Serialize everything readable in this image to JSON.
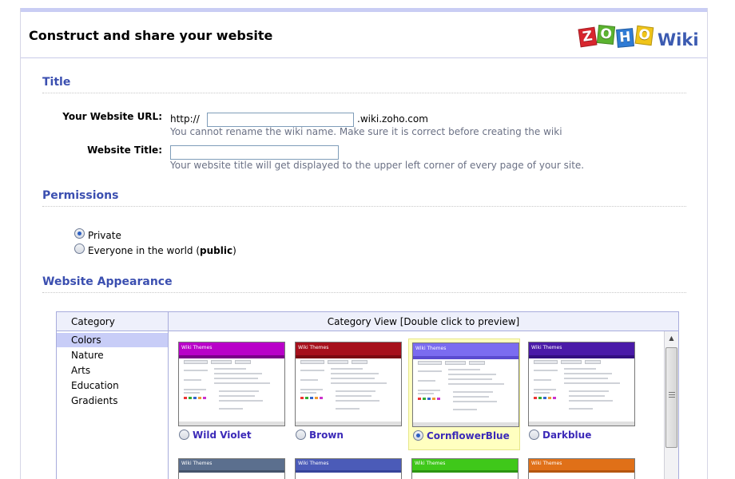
{
  "header": {
    "title": "Construct and share your website",
    "logo_letters": [
      "Z",
      "O",
      "H",
      "O"
    ],
    "logo_word": "Wiki"
  },
  "sections": {
    "title": "Title",
    "permissions": "Permissions",
    "appearance": "Website Appearance"
  },
  "form": {
    "url_label": "Your Website URL:",
    "url_prefix": "http://",
    "url_value": "",
    "url_suffix": ".wiki.zoho.com",
    "url_hint": "You cannot rename the wiki name. Make sure it is correct before creating the wiki",
    "title_label": "Website Title:",
    "title_value": "",
    "title_hint": "Your website title will get displayed to the upper left corner of every page of your site."
  },
  "permissions": {
    "options": [
      {
        "label": "Private",
        "selected": true
      },
      {
        "label_prefix": "Everyone in the world (",
        "label_bold": "public",
        "label_suffix": ")",
        "selected": false
      }
    ]
  },
  "appearance": {
    "category_header": "Category",
    "view_header": "Category View [Double click to preview]",
    "categories": [
      "Colors",
      "Nature",
      "Arts",
      "Education",
      "Gradients"
    ],
    "selected_category": "Colors",
    "themes": [
      {
        "name": "Wild Violet",
        "color": "#b800c8",
        "accent": "#7a0088",
        "selected": false
      },
      {
        "name": "Brown",
        "color": "#a6101c",
        "accent": "#7a0a12",
        "selected": false
      },
      {
        "name": "CornflowerBlue",
        "color": "#7b6cf0",
        "accent": "#5a4bd0",
        "selected": true
      },
      {
        "name": "Darkblue",
        "color": "#4a1aa8",
        "accent": "#330f80",
        "selected": false
      }
    ],
    "themes_row2": [
      {
        "color": "#5b6f8e",
        "accent": "#44536b"
      },
      {
        "color": "#4b5bb8",
        "accent": "#36449a"
      },
      {
        "color": "#3fc81a",
        "accent": "#2d9512"
      },
      {
        "color": "#e07018",
        "accent": "#b55610"
      }
    ],
    "thumb_bar_text": "Wiki Themes"
  },
  "colors": {
    "section_blue": "#3b4fb0",
    "hint_gray": "#6b7185",
    "panel_border": "#a8acdc"
  }
}
